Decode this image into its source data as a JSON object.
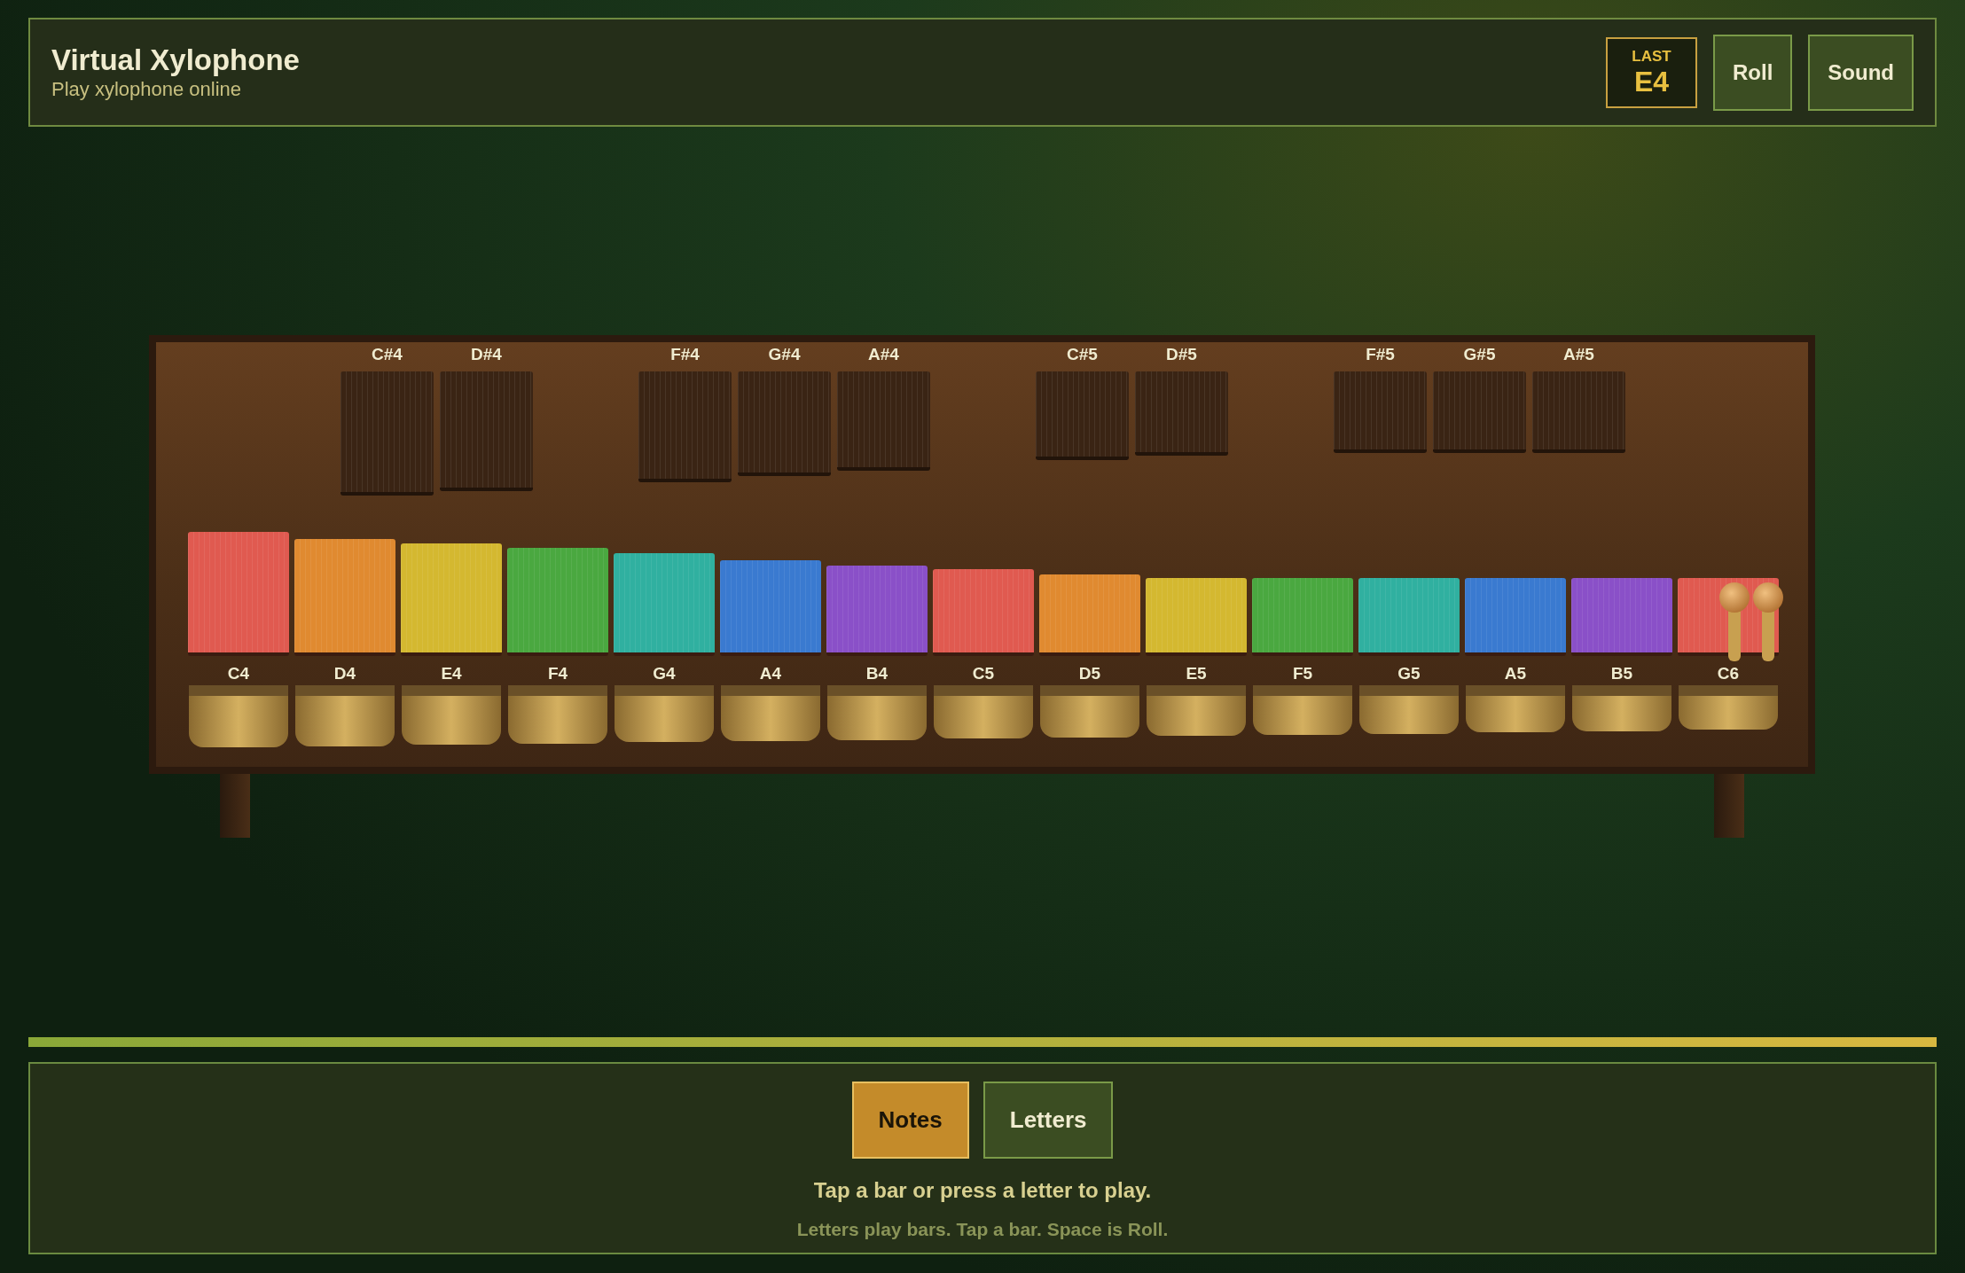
{
  "header": {
    "title": "Virtual Xylophone",
    "subtitle": "Play xylophone online",
    "last": {
      "label": "LAST",
      "note": "E4"
    },
    "buttons": [
      "Roll",
      "Sound"
    ]
  },
  "sharps": [
    {
      "label": "C#4"
    },
    {
      "label": "D#4"
    },
    {
      "label": "F#4"
    },
    {
      "label": "G#4"
    },
    {
      "label": "A#4"
    },
    {
      "label": "C#5"
    },
    {
      "label": "D#5"
    },
    {
      "label": "F#5"
    },
    {
      "label": "G#5"
    },
    {
      "label": "A#5"
    }
  ],
  "bars": [
    {
      "label": "C4",
      "color": "#e05a50"
    },
    {
      "label": "D4",
      "color": "#e08a30"
    },
    {
      "label": "E4",
      "color": "#d4b830"
    },
    {
      "label": "F4",
      "color": "#4aa840"
    },
    {
      "label": "G4",
      "color": "#30b0a0"
    },
    {
      "label": "A4",
      "color": "#3a7ad0"
    },
    {
      "label": "B4",
      "color": "#8a50c8"
    },
    {
      "label": "C5",
      "color": "#e05a50"
    },
    {
      "label": "D5",
      "color": "#e08a30"
    },
    {
      "label": "E5",
      "color": "#d4b830"
    },
    {
      "label": "F5",
      "color": "#4aa840"
    },
    {
      "label": "G5",
      "color": "#30b0a0"
    },
    {
      "label": "A5",
      "color": "#3a7ad0"
    },
    {
      "label": "B5",
      "color": "#8a50c8"
    },
    {
      "label": "C6",
      "color": "#e05a50"
    }
  ],
  "modes": [
    {
      "label": "Notes",
      "selected": true
    },
    {
      "label": "Letters",
      "selected": false
    }
  ],
  "hint": "Tap a bar or press a letter to play.",
  "subhint": "Letters play bars. Tap a bar. Space is Roll."
}
